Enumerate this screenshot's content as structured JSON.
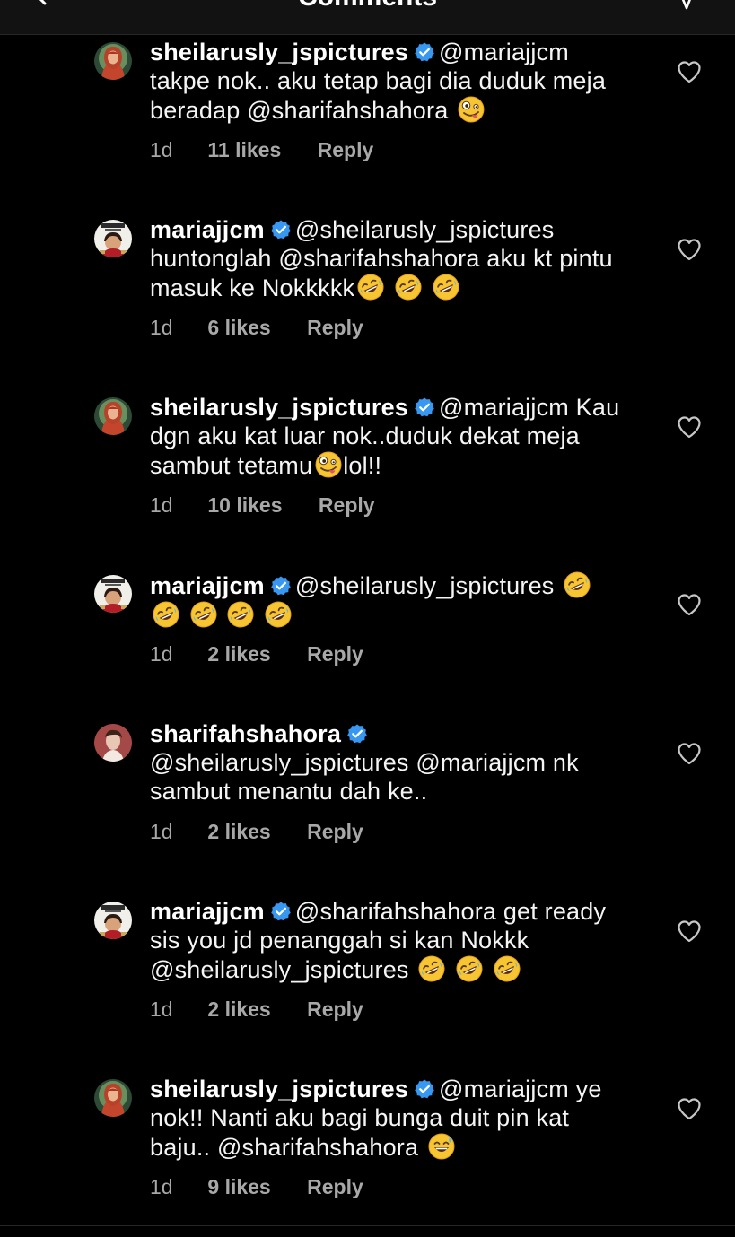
{
  "header": {
    "title": "Comments",
    "back_icon": "chevron-left-icon",
    "send_icon": "send-icon"
  },
  "colors": {
    "background": "#000000",
    "text": "#ffffff",
    "muted": "#a8a8a8",
    "verified": "#3897f0"
  },
  "comments": [
    {
      "username": "sheilarusly_jspictures",
      "verified": true,
      "avatar": "avatar-sheilarusly",
      "lines": [
        "@mariajjcm",
        "takpe nok.. aku tetap bagi dia duduk meja",
        "beradap @sharifahshahora"
      ],
      "emojis": [
        "zany-face"
      ],
      "time": "1d",
      "likes": "11 likes",
      "reply": "Reply"
    },
    {
      "username": "mariajjcm",
      "verified": true,
      "avatar": "avatar-mariajjcm",
      "lines": [
        "@sheilarusly_jspictures",
        "huntonglah @sharifahshahora aku kt pintu",
        "masuk ke Nokkkkk"
      ],
      "emojis": [
        "rofl",
        "rofl",
        "rofl"
      ],
      "time": "1d",
      "likes": "6 likes",
      "reply": "Reply"
    },
    {
      "username": "sheilarusly_jspictures",
      "verified": true,
      "avatar": "avatar-sheilarusly",
      "lines": [
        "@mariajjcm Kau",
        "dgn aku kat luar nok..duduk dekat meja",
        "sambut tetamu",
        "lol!!"
      ],
      "emojis": [
        "zany-face"
      ],
      "time": "1d",
      "likes": "10 likes",
      "reply": "Reply"
    },
    {
      "username": "mariajjcm",
      "verified": true,
      "avatar": "avatar-mariajjcm",
      "lines": [
        "@sheilarusly_jspictures"
      ],
      "emojis": [
        "rofl",
        "rofl",
        "rofl",
        "rofl",
        "rofl"
      ],
      "time": "1d",
      "likes": "2 likes",
      "reply": "Reply"
    },
    {
      "username": "sharifahshahora",
      "verified": true,
      "avatar": "avatar-sharifahshahora",
      "lines": [
        "@sheilarusly_jspictures @mariajjcm nk",
        "sambut menantu dah ke.."
      ],
      "emojis": [],
      "time": "1d",
      "likes": "2 likes",
      "reply": "Reply"
    },
    {
      "username": "mariajjcm",
      "verified": true,
      "avatar": "avatar-mariajjcm",
      "lines": [
        "@sharifahshahora get ready",
        "sis you jd penanggah si kan Nokkk",
        "@sheilarusly_jspictures"
      ],
      "emojis": [
        "rofl",
        "rofl",
        "rofl"
      ],
      "time": "1d",
      "likes": "2 likes",
      "reply": "Reply"
    },
    {
      "username": "sheilarusly_jspictures",
      "verified": true,
      "avatar": "avatar-sheilarusly",
      "lines": [
        "@mariajjcm ye",
        "nok!! Nanti aku bagi bunga duit pin kat",
        "baju.. @sharifahshahora"
      ],
      "emojis": [
        "grinning-sweat"
      ],
      "time": "1d",
      "likes": "9 likes",
      "reply": "Reply"
    }
  ]
}
